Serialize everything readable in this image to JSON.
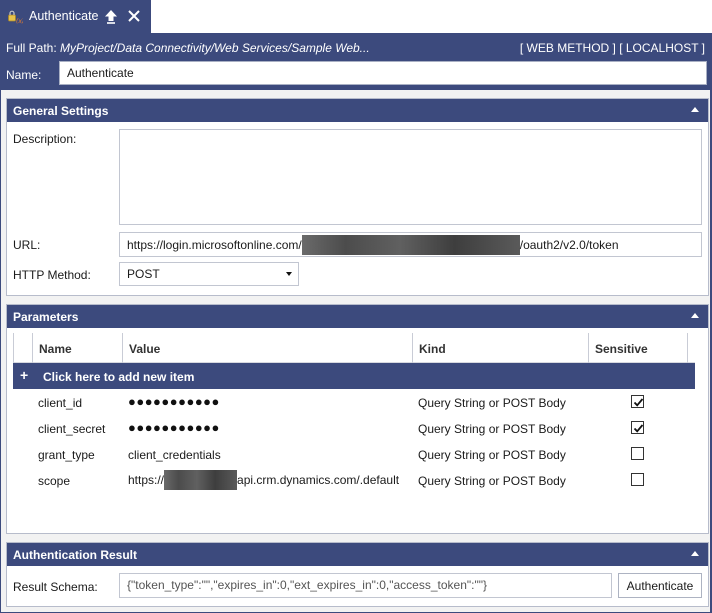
{
  "tab": {
    "title": "Authenticate"
  },
  "header": {
    "full_path_label": "Full Path:",
    "full_path_value": "MyProject/Data Connectivity/Web Services/Sample Web...",
    "right_text": "[ WEB METHOD ] [ LOCALHOST ]",
    "name_label": "Name:",
    "name_value": "Authenticate"
  },
  "general": {
    "title": "General Settings",
    "description_label": "Description:",
    "description_value": "",
    "url_label": "URL:",
    "url_prefix": "https://login.microsoftonline.com/",
    "url_suffix": "/oauth2/v2.0/token",
    "http_method_label": "HTTP Method:",
    "http_method_value": "POST"
  },
  "parameters": {
    "title": "Parameters",
    "columns": [
      "Name",
      "Value",
      "Kind",
      "Sensitive"
    ],
    "add_label": "Click here to add new item",
    "rows": [
      {
        "name": "client_id",
        "value": "●●●●●●●●●●●",
        "masked": true,
        "kind": "Query String or POST Body",
        "sensitive": true
      },
      {
        "name": "client_secret",
        "value": "●●●●●●●●●●●",
        "masked": true,
        "kind": "Query String or POST Body",
        "sensitive": true
      },
      {
        "name": "grant_type",
        "value": "client_credentials",
        "masked": false,
        "kind": "Query String or POST Body",
        "sensitive": false
      },
      {
        "name": "scope",
        "value_prefix": "https://",
        "value_suffix": "api.crm.dynamics.com/.default",
        "redacted": true,
        "kind": "Query String or POST Body",
        "sensitive": false
      }
    ]
  },
  "auth_result": {
    "title": "Authentication Result",
    "schema_label": "Result Schema:",
    "schema_value": "{\"token_type\":\"\",\"expires_in\":0,\"ext_expires_in\":0,\"access_token\":\"\"}",
    "button_label": "Authenticate"
  },
  "colors": {
    "accent": "#3c4a7d",
    "panel_bg": "#f2f2f2"
  }
}
